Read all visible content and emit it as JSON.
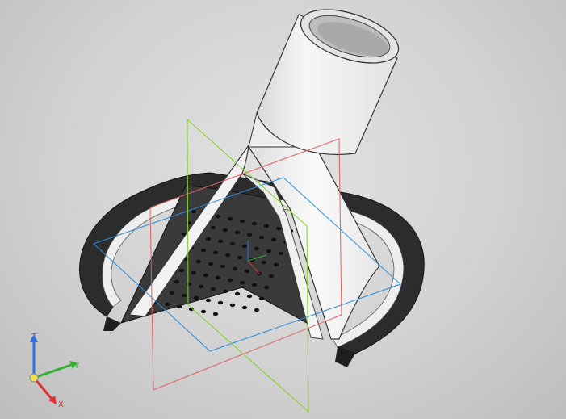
{
  "viewport": {
    "background": "#d4d4d4",
    "model": "funnel-nozzle-section-view"
  },
  "planes": {
    "front_color": "#e06060",
    "right_color": "#7ed321",
    "top_color": "#2b8cdb"
  },
  "triad": {
    "x_label": "X",
    "y_label": "Y",
    "z_label": "Z",
    "x_color": "#e03030",
    "y_color": "#30b030",
    "z_color": "#3070e0"
  }
}
